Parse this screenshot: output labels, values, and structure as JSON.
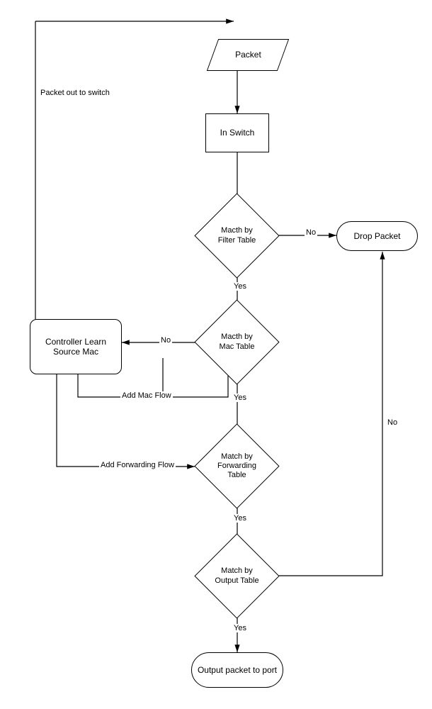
{
  "nodes": {
    "packet": "Packet",
    "inSwitch": "In Switch",
    "filterTable": "Macth by Filter Table",
    "dropPacket": "Drop Packet",
    "macTable": "Macth by Mac Table",
    "controllerLearn": "Controller Learn Source Mac",
    "forwardingTable": "Match by Forwarding Table",
    "outputTable": "Match by Output Table",
    "outputPort": "Output packet to port"
  },
  "edges": {
    "yes1": "Yes",
    "yes2": "Yes",
    "yes3": "Yes",
    "yes4": "Yes",
    "no1": "No",
    "no2": "No",
    "no3": "No",
    "packetOut": "Packet out  to switch",
    "addMacFlow": "Add Mac Flow",
    "addForwardingFlow": "Add Forwarding Flow"
  }
}
